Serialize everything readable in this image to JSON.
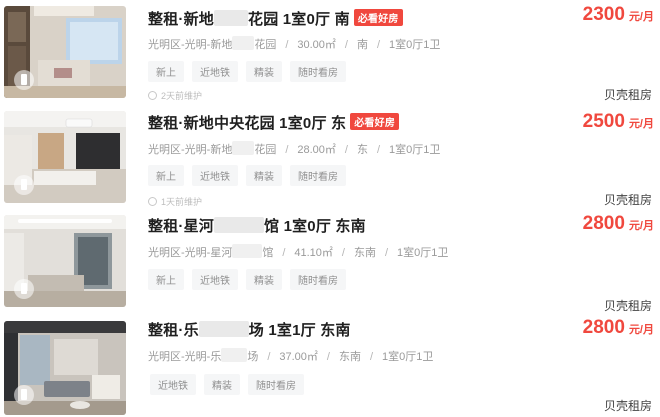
{
  "listings": [
    {
      "title": "整租·新地",
      "title_tail": "花园 1室0厅 南",
      "badge": "必看好房",
      "address_area": "光明区-光明-新地",
      "address_tail": "花园",
      "size": "30.00㎡",
      "orientation": "南",
      "layout": "1室0厅1卫",
      "tags": [
        "新上",
        "近地铁",
        "精装",
        "随时看房"
      ],
      "maintained": "2天前维护",
      "price": "2300",
      "price_unit": "元/月",
      "source": "贝壳租房"
    },
    {
      "title": "整租·新地中央花园 1室0厅 东",
      "title_tail": "",
      "badge": "必看好房",
      "address_area": "光明区-光明-新地",
      "address_tail": "花园",
      "size": "28.00㎡",
      "orientation": "东",
      "layout": "1室0厅1卫",
      "tags": [
        "新上",
        "近地铁",
        "精装",
        "随时看房"
      ],
      "maintained": "1天前维护",
      "price": "2500",
      "price_unit": "元/月",
      "source": "贝壳租房"
    },
    {
      "title": "整租·星河",
      "title_tail": "馆 1室0厅 东南",
      "badge": "",
      "address_area": "光明区-光明-星河",
      "address_tail": "馆",
      "size": "41.10㎡",
      "orientation": "东南",
      "layout": "1室0厅1卫",
      "tags": [
        "新上",
        "近地铁",
        "精装",
        "随时看房"
      ],
      "maintained": "",
      "price": "2800",
      "price_unit": "元/月",
      "source": "贝壳租房"
    },
    {
      "title": "整租·乐",
      "title_tail": "场 1室1厅 东南",
      "badge": "",
      "address_area": "光明区-光明-乐",
      "address_tail": "场",
      "size": "37.00㎡",
      "orientation": "东南",
      "layout": "1室0厅1卫",
      "tags": [
        "近地铁",
        "精装",
        "随时看房"
      ],
      "maintained": "",
      "price": "2800",
      "price_unit": "元/月",
      "source": "贝壳租房"
    }
  ]
}
